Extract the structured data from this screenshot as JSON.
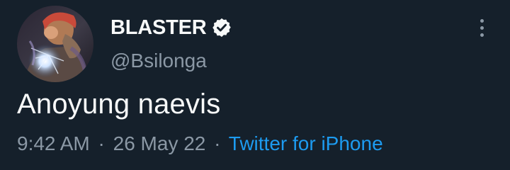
{
  "tweet": {
    "author": {
      "display_name": "BLASTER",
      "verified_icon": "verified-badge-icon",
      "handle": "@Bsilonga",
      "avatar": "profile-photo"
    },
    "more_icon": "more-vertical-icon",
    "text": "Anoyung naevis",
    "meta": {
      "time": "9:42 AM",
      "separator": "·",
      "date": "26 May 22",
      "source": "Twitter for iPhone"
    }
  },
  "colors": {
    "background": "#15202b",
    "text_primary": "#f7f9f9",
    "text_secondary": "#8b98a5",
    "link": "#1d9bf0"
  }
}
